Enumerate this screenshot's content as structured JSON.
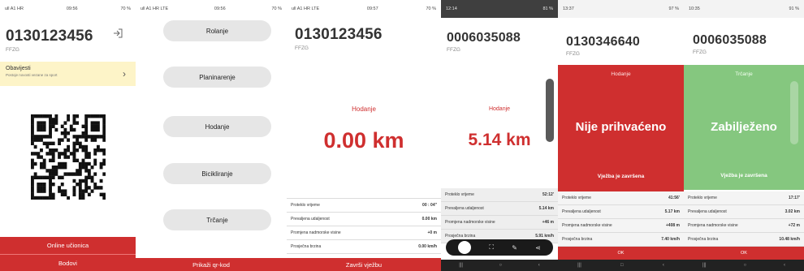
{
  "panel1": {
    "status": {
      "left": "ull A1 HR",
      "time": "09:56",
      "right": "70 %"
    },
    "id": "0130123456",
    "org": "FFZG",
    "notice": {
      "title": "Obavijesti",
      "subtitle": "Postoje novosti vezane za sport"
    },
    "buttons": {
      "online": "Online učionica",
      "points": "Bodovi"
    },
    "icons": {
      "logout": "logout-icon",
      "chevron": "chevron-right-icon",
      "qr": "qr-code"
    }
  },
  "panel2": {
    "status": {
      "left": "ull A1 HR LTE",
      "time": "09:56",
      "right": "70 %"
    },
    "activities": [
      "Rolanje",
      "Planinarenje",
      "Hodanje",
      "Bicikliranje",
      "Trčanje"
    ],
    "qr_button": "Prikaži qr-kod"
  },
  "panel3": {
    "status": {
      "left": "ull A1 HR LTE",
      "time": "09:57",
      "right": "70 %"
    },
    "id": "0130123456",
    "org": "FFZG",
    "activity": "Hodanje",
    "distance": "0.00 km",
    "stats": [
      {
        "label": "Proteklo vrijeme",
        "value": "00 : 04''"
      },
      {
        "label": "Prevaljena udaljenost",
        "value": "0.00 km"
      },
      {
        "label": "Promjena nadmorske visine",
        "value": "+0 m"
      },
      {
        "label": "Prosječna brzina",
        "value": "0.00 km/h"
      }
    ],
    "finish": "Završi vježbu"
  },
  "panel4": {
    "status": {
      "left": "12:14",
      "right": "81 %"
    },
    "id": "0006035088",
    "org": "FFZG",
    "activity": "Hodanje",
    "distance": "5.14 km",
    "stats": [
      {
        "label": "Proteklo vrijeme",
        "value": "52:12'"
      },
      {
        "label": "Prevaljena udaljenost",
        "value": "5.14 km"
      },
      {
        "label": "Promjena nadmorske visine",
        "value": "+46 m"
      },
      {
        "label": "Prosječna brzina",
        "value": "5.91 km/h"
      }
    ]
  },
  "panel5": {
    "status": {
      "left": "13:37",
      "right": "97 %"
    },
    "id": "0130346640",
    "org": "FFZG",
    "activity": "Hodanje",
    "result": "Nije prihvaćeno",
    "done": "Vježba je završena",
    "stats": [
      {
        "label": "Proteklo vrijeme",
        "value": "41:56'"
      },
      {
        "label": "Prevaljena udaljenost",
        "value": "5.17 km"
      },
      {
        "label": "Promjena nadmorske visine",
        "value": "+408 m"
      },
      {
        "label": "Prosječna brzina",
        "value": "7.40 km/h"
      }
    ],
    "ok": "OK"
  },
  "panel6": {
    "status": {
      "left": "10:35",
      "right": "91 %"
    },
    "id": "0006035088",
    "org": "FFZG",
    "activity": "Trčanje",
    "result": "Zabilježeno",
    "done": "Vježba je završena",
    "stats": [
      {
        "label": "Proteklo vrijeme",
        "value": "17:17'"
      },
      {
        "label": "Prevaljena udaljenost",
        "value": "3.02 km"
      },
      {
        "label": "Promjena nadmorske visine",
        "value": "+72 m"
      },
      {
        "label": "Prosječna brzina",
        "value": "10.48 km/h"
      }
    ],
    "ok": "OK"
  },
  "colors": {
    "red": "#cf2f2f",
    "green": "#85c77f",
    "notice": "#fdf4c8"
  }
}
